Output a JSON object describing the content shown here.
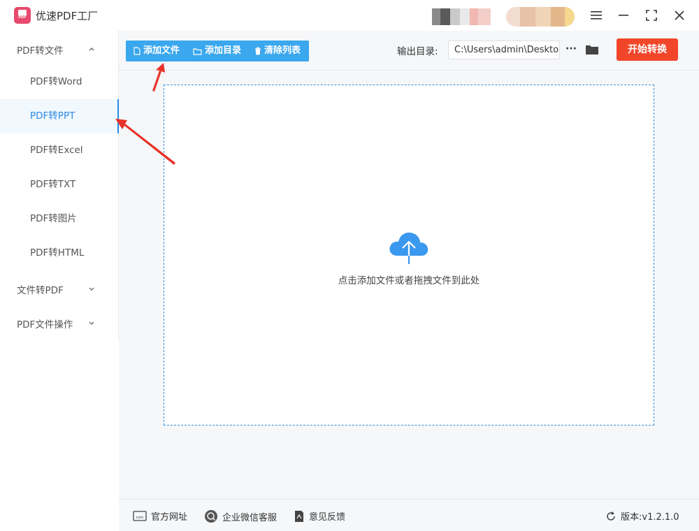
{
  "app": {
    "title": "优速PDF工厂",
    "logo_text": "PDF"
  },
  "sidebar": {
    "groups": [
      {
        "label": "PDF转文件",
        "expanded": true
      },
      {
        "label": "文件转PDF",
        "expanded": false
      },
      {
        "label": "PDF文件操作",
        "expanded": false
      }
    ],
    "items": [
      {
        "label": "PDF转Word"
      },
      {
        "label": "PDF转PPT",
        "active": true
      },
      {
        "label": "PDF转Excel"
      },
      {
        "label": "PDF转TXT"
      },
      {
        "label": "PDF转图片"
      },
      {
        "label": "PDF转HTML"
      }
    ]
  },
  "toolbar": {
    "add_file": "添加文件",
    "add_folder": "添加目录",
    "clear_list": "清除列表",
    "output_label": "输出目录:",
    "output_path": "C:\\Users\\admin\\Desktop",
    "more": "···",
    "start": "开始转换"
  },
  "dropzone": {
    "hint": "点击添加文件或者拖拽文件到此处"
  },
  "footer": {
    "website": "官方网址",
    "wechat": "企业微信客服",
    "feedback": "意见反馈",
    "version": "版本:v1.2.1.0"
  },
  "colors": {
    "primary": "#3aa7ee",
    "active": "#2b8ae3",
    "start": "#f2462a",
    "annotation": "#e8322a",
    "logo": "#e74a6d"
  },
  "icons": {
    "menu": "menu-icon",
    "minimize": "minimize-icon",
    "maximize": "maximize-icon",
    "close": "close-icon",
    "upload": "cloud-upload-icon",
    "folder": "folder-icon"
  }
}
